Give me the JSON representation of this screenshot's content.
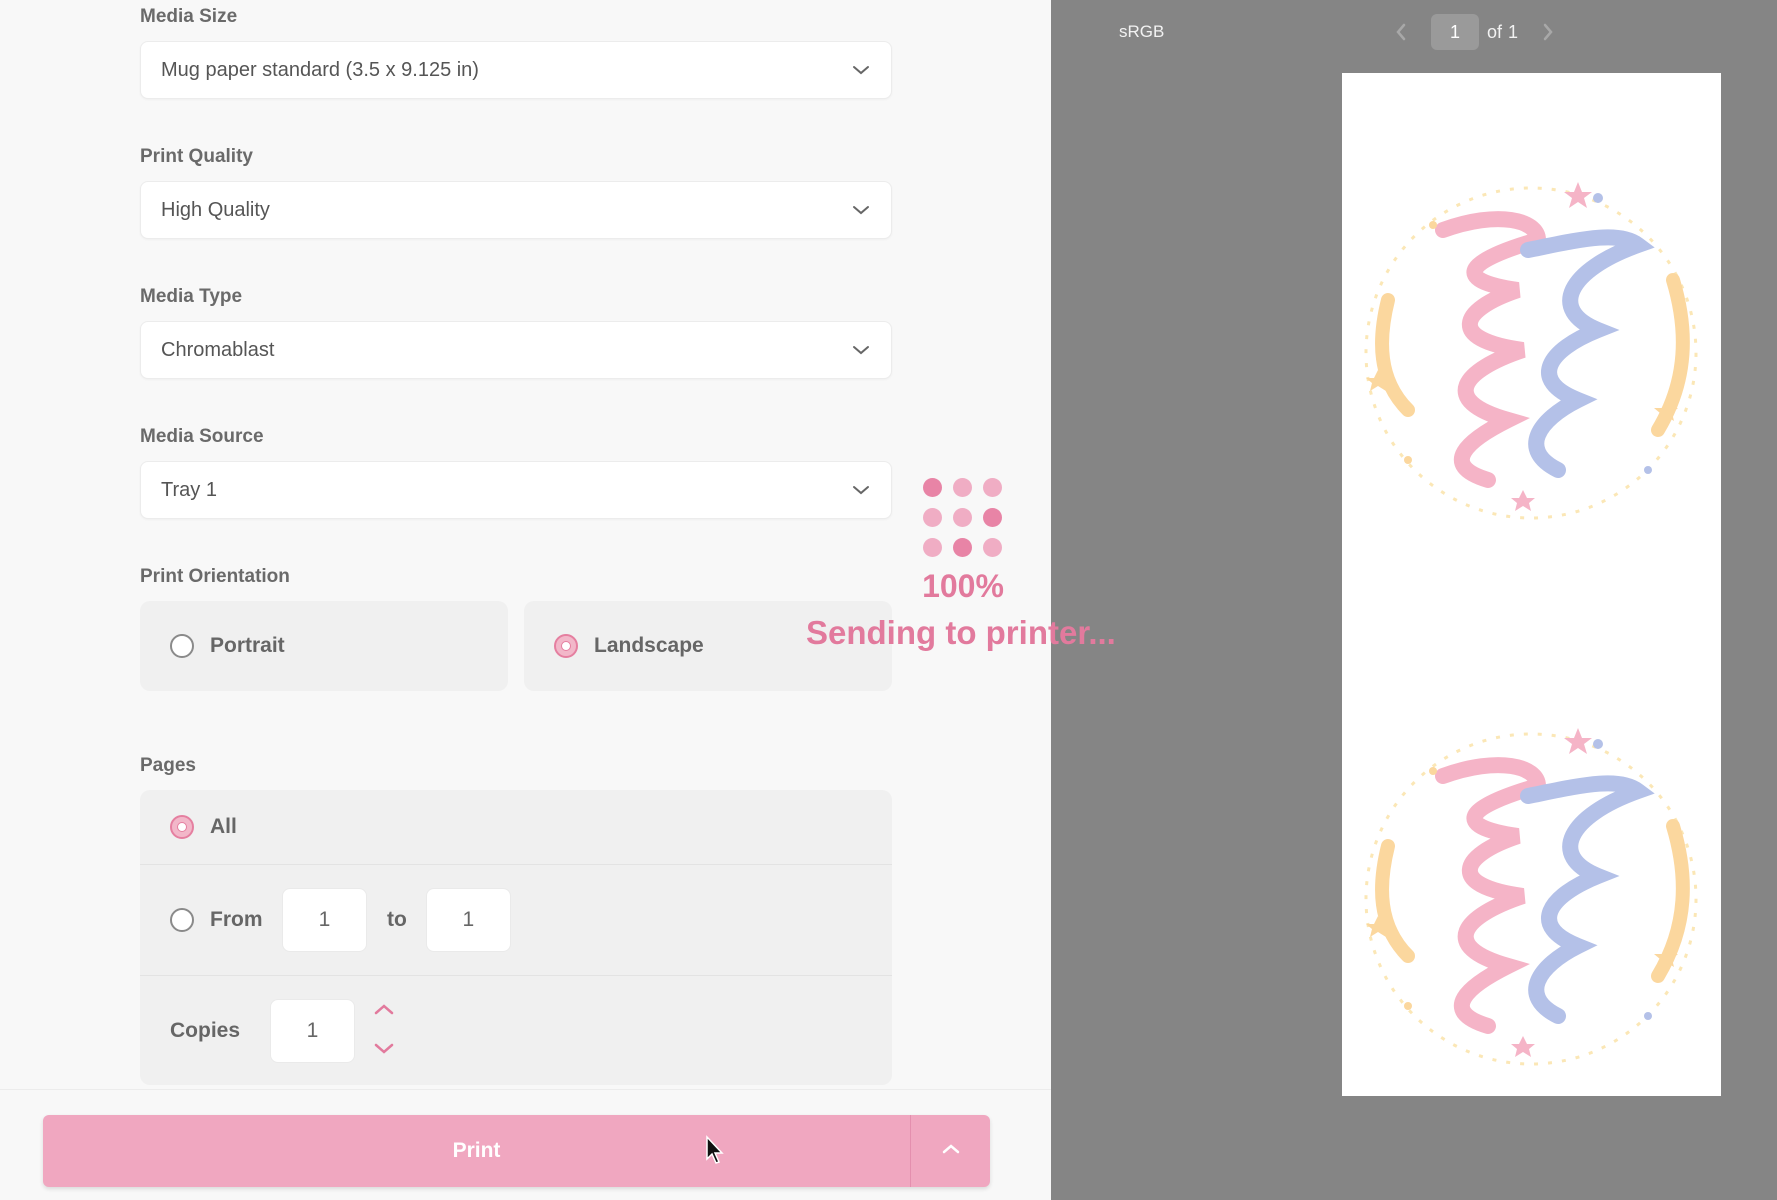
{
  "settings": {
    "media_size": {
      "label": "Media Size",
      "value": "Mug paper standard (3.5 x 9.125 in)"
    },
    "print_quality": {
      "label": "Print Quality",
      "value": "High Quality"
    },
    "media_type": {
      "label": "Media Type",
      "value": "Chromablast"
    },
    "media_source": {
      "label": "Media Source",
      "value": "Tray 1"
    },
    "orientation": {
      "label": "Print Orientation",
      "options": [
        "Portrait",
        "Landscape"
      ],
      "selected": "Landscape"
    },
    "pages": {
      "label": "Pages",
      "all_label": "All",
      "selected": "All",
      "from_label": "From",
      "from_value": "1",
      "to_label": "to",
      "to_value": "1"
    },
    "copies": {
      "label": "Copies",
      "value": "1"
    }
  },
  "overlay": {
    "progress_percent": "100%",
    "message": "Sending to printer..."
  },
  "print_button": {
    "label": "Print"
  },
  "preview": {
    "color_space": "sRGB",
    "current_page": "1",
    "of_label": "of",
    "total_pages": "1"
  },
  "colors": {
    "accent_pink": "#e27a9d",
    "button_pink": "#f0a7c0",
    "preview_bg": "#858585"
  },
  "icons": [
    "chevron-down-icon",
    "chevron-up-icon",
    "chevron-left-icon",
    "chevron-right-icon",
    "cursor-icon"
  ]
}
